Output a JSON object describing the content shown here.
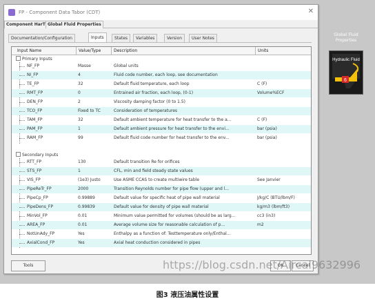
{
  "window": {
    "title": "FP - Component Data Tabor (CDT)",
    "close_glyph": "✕",
    "top_tabs": [
      "Component HarTF",
      "Global Fluid Properties"
    ],
    "sub_tabs": [
      "Documentation/Configuration",
      "Inputs",
      "States",
      "Variables",
      "Version",
      "User Notes"
    ],
    "active_sub_tab": "Inputs"
  },
  "table": {
    "columns": [
      "Input Name",
      "Value/Type",
      "Description",
      "Units"
    ],
    "groups": [
      "Primary Inputs",
      "Secondary Inputs"
    ],
    "primary_rows": [
      {
        "name": "NF_FP",
        "value": "Masse",
        "desc": "Global units",
        "unit": ""
      },
      {
        "name": "NI_FP",
        "value": "4",
        "desc": "Fluid code number, each loop, see documentation",
        "unit": ""
      },
      {
        "name": "TE_FP",
        "value": "32",
        "desc": "Default fluid temperature, each loop",
        "unit": "C (F)"
      },
      {
        "name": "RMT_FP",
        "value": "0",
        "desc": "Entrained air fraction, each loop, (0-1)",
        "unit": "Volume%ECF"
      },
      {
        "name": "DEN_FP",
        "value": "2",
        "desc": "Viscosity damping factor (0 to 1.5)",
        "unit": ""
      },
      {
        "name": "TCO_FP",
        "value": "Fixed to TC",
        "desc": "Consideration of temperatures",
        "unit": ""
      },
      {
        "name": "TAM_FP",
        "value": "32",
        "desc": "Default ambient temperature for heat transfer to the a...",
        "unit": "C (F)"
      },
      {
        "name": "PAM_FP",
        "value": "1",
        "desc": "Default ambient pressure for heat transfer to the envi...",
        "unit": "bar (psia)"
      },
      {
        "name": "RAM_FP",
        "value": "99",
        "desc": "Default fluid code number for heat transfer to the env...",
        "unit": "bar (psia)"
      }
    ],
    "secondary_rows": [
      {
        "name": "RTT_FP",
        "value": "130",
        "desc": "Default transition Re for orifices",
        "unit": ""
      },
      {
        "name": "STS_FP",
        "value": "1",
        "desc": "CFL, min and field steady state values",
        "unit": ""
      },
      {
        "name": "VIS_FP",
        "value": "(1e3) Justo",
        "desc": "Use ASME CCAS to create multiwire table",
        "unit": "See Janvier"
      },
      {
        "name": "PipeReTr_FP",
        "value": "2000",
        "desc": "Transition Reynolds number for pipe flow (upper and l...",
        "unit": ""
      },
      {
        "name": "PipeCp_FP",
        "value": "0.99889",
        "desc": "Default value for specific heat of pipe wall material",
        "unit": "J/kg/C (BTU/lbm/F)"
      },
      {
        "name": "PipeDens_FP",
        "value": "0.99839",
        "desc": "Default value for density of pipe wall material",
        "unit": "kg/m3 (lbm/ft3)"
      },
      {
        "name": "MinVol_FP",
        "value": "0.01",
        "desc": "Minimum value permitted for volumes (should be as larg...",
        "unit": "cc3 (in3)"
      },
      {
        "name": "AREA_FP",
        "value": "0.01",
        "desc": "Average volume size for reasonable calculation of p...",
        "unit": "m2"
      },
      {
        "name": "NotUnAdy_FP",
        "value": "Yes",
        "desc": "Enthalpy as a function of: Testtemperature only/Enthal...",
        "unit": ""
      },
      {
        "name": "AxialCond_FP",
        "value": "Yes",
        "desc": "Axial heat conduction considered in pipes",
        "unit": ""
      }
    ]
  },
  "buttons": {
    "tools": "Tools",
    "ok": "OK",
    "cancel": "Cancel"
  },
  "aside": {
    "label": "Global Fluid Properties",
    "card_text": "Hydraulic Fluid",
    "card_badge": "6"
  },
  "watermark": "https://blog.csdn.net/Aircal9632996",
  "caption": "图3 液压油属性设置",
  "colors": {
    "row_alt": "#dff7f7",
    "stage": "#c8c8c8",
    "icon_accent": "#8a6bd1"
  }
}
